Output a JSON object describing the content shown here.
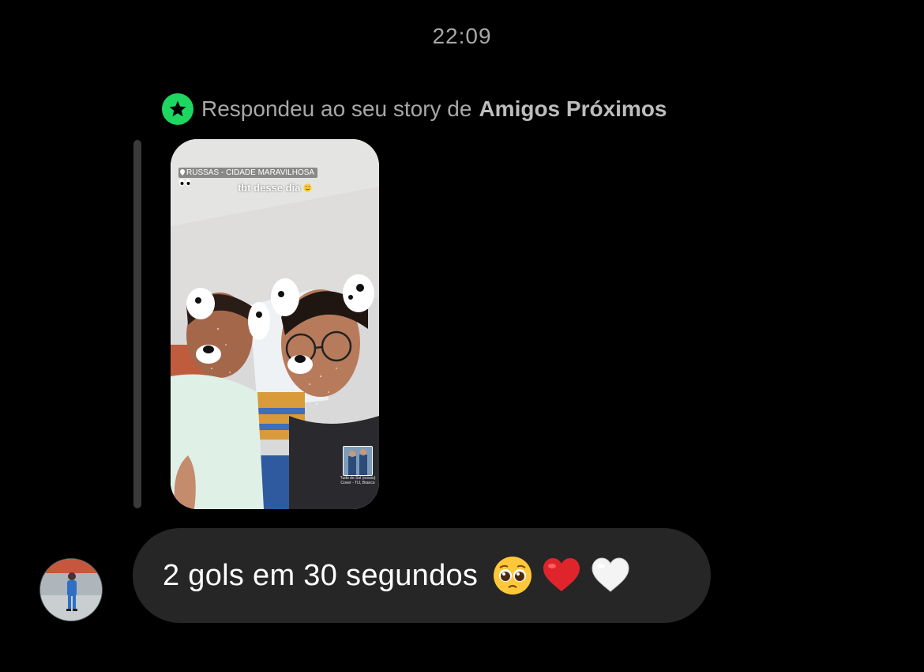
{
  "header": {
    "timestamp": "22:09"
  },
  "reply_context": {
    "badge_icon": "close-friends-star-icon",
    "badge_color": "#1ed760",
    "prefix_text": "Respondeu ao seu story de",
    "audience_label": "Amigos Próximos"
  },
  "story": {
    "location_sticker": "RUSSAS - CIDADE MARAVILHOSA",
    "caption": "tbt desse dia",
    "caption_emoji": "smiling-face-emoji",
    "music_label_line1": "Tudo de Sol (nosso)",
    "music_label_line2": "Cover - TIJ, Branco"
  },
  "message": {
    "text": "2 gols em 30 segundos",
    "emojis": [
      "pleading-face-emoji",
      "red-heart-emoji",
      "white-heart-emoji"
    ]
  },
  "colors": {
    "background": "#000000",
    "bubble": "#262626",
    "muted_text": "#a8a8a8",
    "reply_bar": "#3a3a3a"
  }
}
